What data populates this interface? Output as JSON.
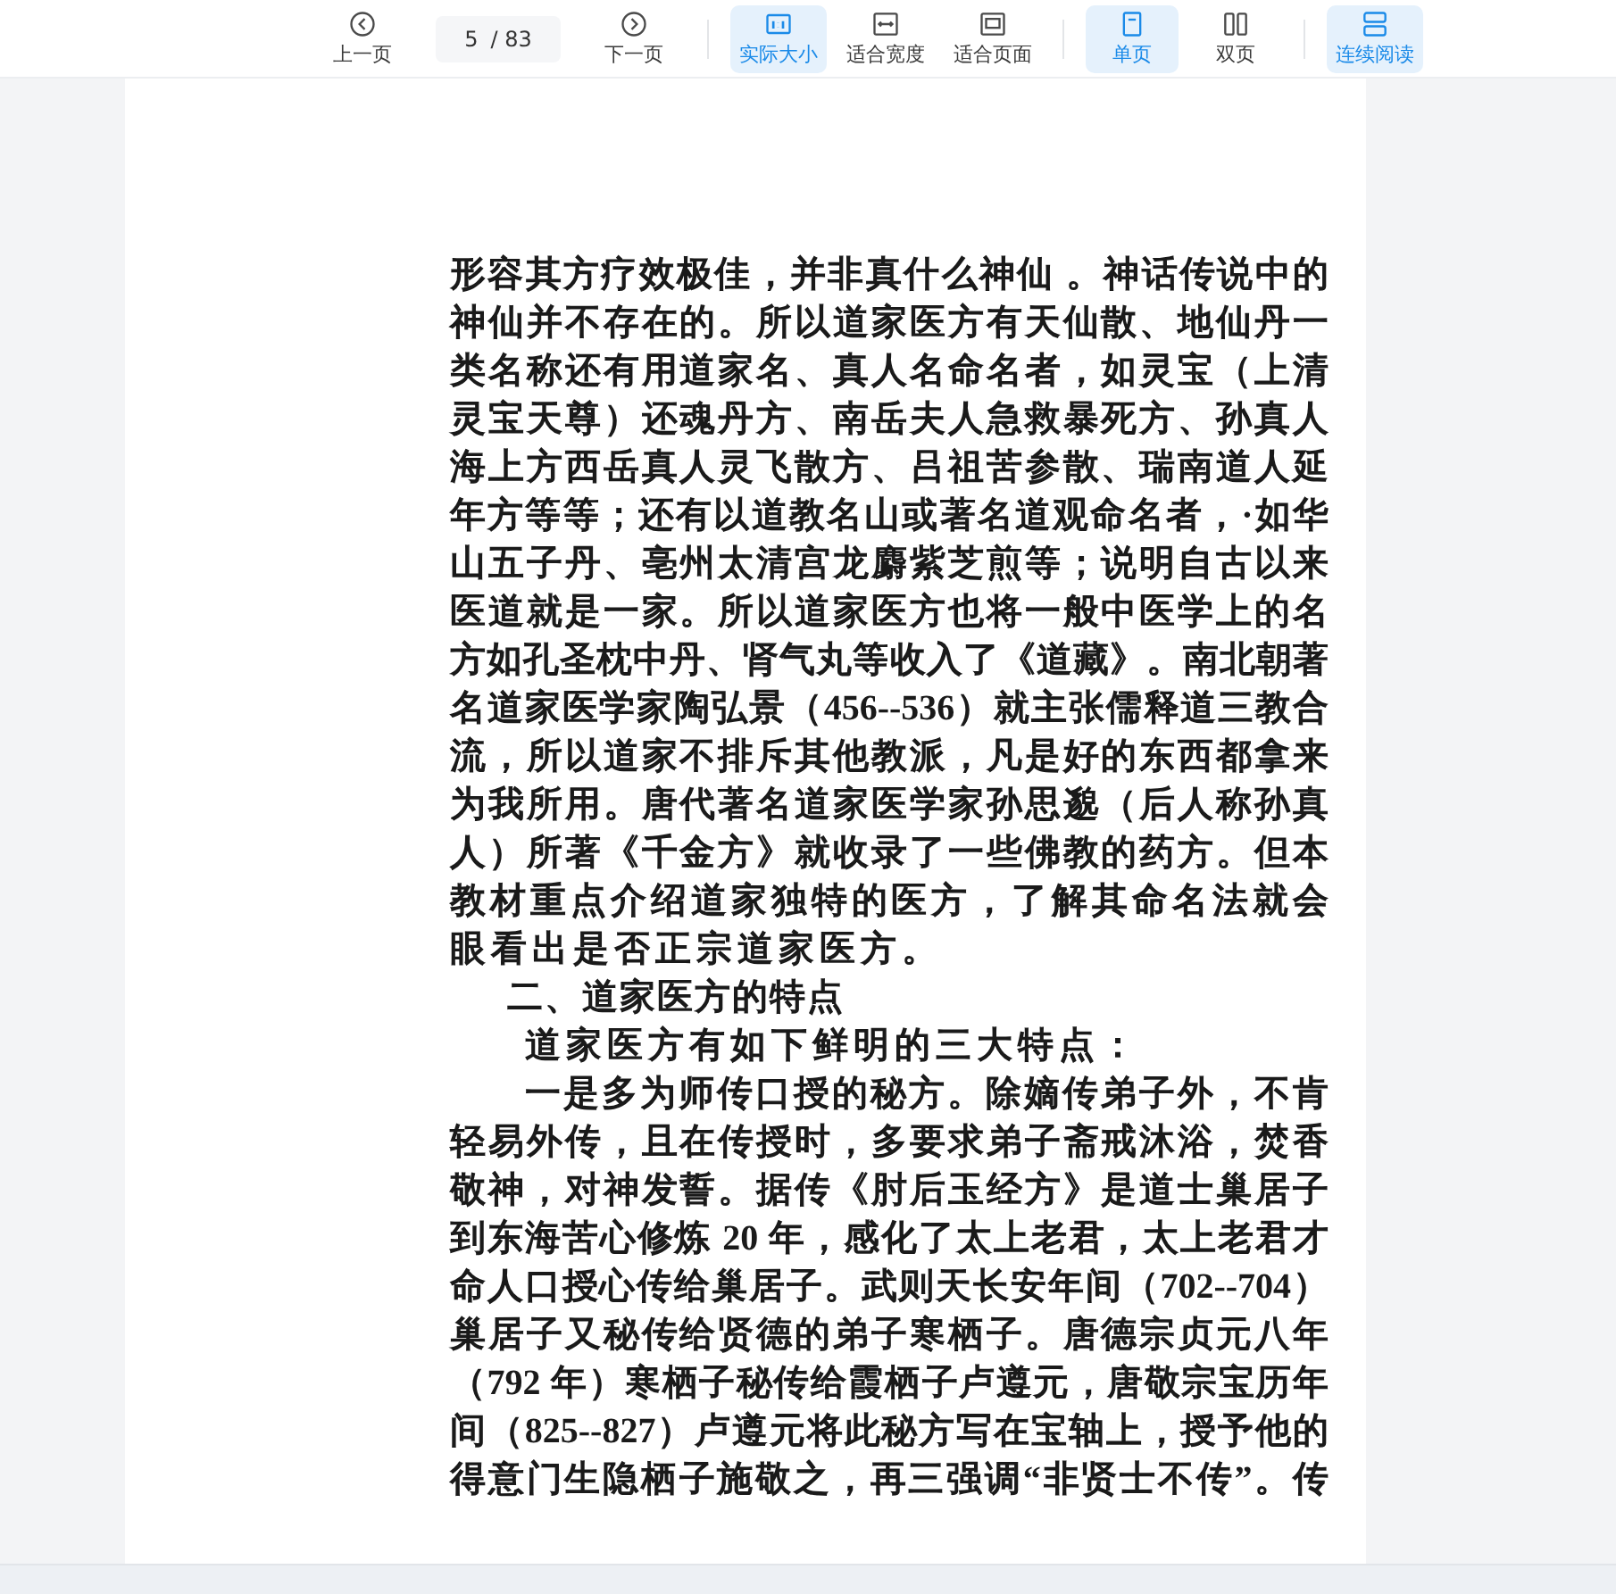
{
  "toolbar": {
    "prev": {
      "label": "上一页",
      "kind": "prev"
    },
    "page_field": {
      "value": "5",
      "total": "/ 83"
    },
    "next": {
      "label": "下一页",
      "kind": "next"
    },
    "groups": [
      [
        {
          "label": "实际大小",
          "kind": "actual",
          "selected": true
        },
        {
          "label": "适合宽度",
          "kind": "fit-width",
          "selected": false
        },
        {
          "label": "适合页面",
          "kind": "fit-page",
          "selected": false
        }
      ],
      [
        {
          "label": "单页",
          "kind": "single",
          "selected": true
        },
        {
          "label": "双页",
          "kind": "double",
          "selected": false
        }
      ],
      [
        {
          "label": "连续阅读",
          "kind": "continuous",
          "selected": true
        }
      ]
    ]
  },
  "document": {
    "lines": [
      {
        "text": "形容其方疗效极佳，并非真什么神仙 。神话传说中的",
        "kind": "body",
        "indent": false
      },
      {
        "text": "神仙并不存在的。所以道家医方有天仙散、地仙丹一",
        "kind": "body",
        "indent": false
      },
      {
        "text": "类名称还有用道家名、真人名命名者，如灵宝（上清",
        "kind": "body",
        "indent": false
      },
      {
        "text": "灵宝天尊）还魂丹方、南岳夫人急救暴死方、孙真人",
        "kind": "body",
        "indent": false
      },
      {
        "text": "海上方西岳真人灵飞散方、吕祖苦参散、瑞南道人延",
        "kind": "body",
        "indent": false
      },
      {
        "text": "年方等等；还有以道教名山或著名道观命名者，·如华",
        "kind": "body",
        "indent": false
      },
      {
        "text": "山五子丹、亳州太清宫龙麝紫芝煎等；说明自古以来",
        "kind": "body",
        "indent": false
      },
      {
        "text": "医道就是一家。所以道家医方也将一般中医学上的名",
        "kind": "body",
        "indent": false
      },
      {
        "text": "方如孔圣枕中丹、肾气丸等收入了《道藏》。南北朝著",
        "kind": "body",
        "indent": false
      },
      {
        "text": "名道家医学家陶弘景（456--536）就主张儒释道三教合",
        "kind": "body",
        "indent": false
      },
      {
        "text": "流，所以道家不排斥其他教派，凡是好的东西都拿来",
        "kind": "body",
        "indent": false
      },
      {
        "text": "为我所用。唐代著名道家医学家孙思邈（后人称孙真",
        "kind": "body",
        "indent": false
      },
      {
        "text": "人）所著《千金方》就收录了一些佛教的药方。但本",
        "kind": "body",
        "indent": false
      },
      {
        "text": "教材重点介绍道家独特的医方，了解其命名法就会",
        "kind": "body",
        "indent": false
      },
      {
        "text": "眼看出是否正宗道家医方。",
        "kind": "end",
        "indent": false
      },
      {
        "text": "二、道家医方的特点",
        "kind": "heading",
        "indent": true
      },
      {
        "text": "道家医方有如下鲜明的三大特点：",
        "kind": "end",
        "indent": true
      },
      {
        "text": "一是多为师传口授的秘方。除嫡传弟子外，不肯",
        "kind": "body",
        "indent": true
      },
      {
        "text": "轻易外传，且在传授时，多要求弟子斋戒沐浴，焚香",
        "kind": "body",
        "indent": false
      },
      {
        "text": "敬神，对神发誓。据传《肘后玉经方》是道士巢居子",
        "kind": "body",
        "indent": false
      },
      {
        "text": "到东海苦心修炼 20 年，感化了太上老君，太上老君才",
        "kind": "body",
        "indent": false
      },
      {
        "text": "命人口授心传给巢居子。武则天长安年间（702--704）",
        "kind": "body",
        "indent": false
      },
      {
        "text": "巢居子又秘传给贤德的弟子寒栖子。唐德宗贞元八年",
        "kind": "body",
        "indent": false
      },
      {
        "text": "（792 年）寒栖子秘传给霞栖子卢遵元，唐敬宗宝历年",
        "kind": "body",
        "indent": false
      },
      {
        "text": "间（825--827）卢遵元将此秘方写在宝轴上，授予他的",
        "kind": "body",
        "indent": false
      },
      {
        "text": "得意门生隐栖子施敬之，再三强调“非贤士不传”。传",
        "kind": "body",
        "indent": false
      }
    ]
  }
}
